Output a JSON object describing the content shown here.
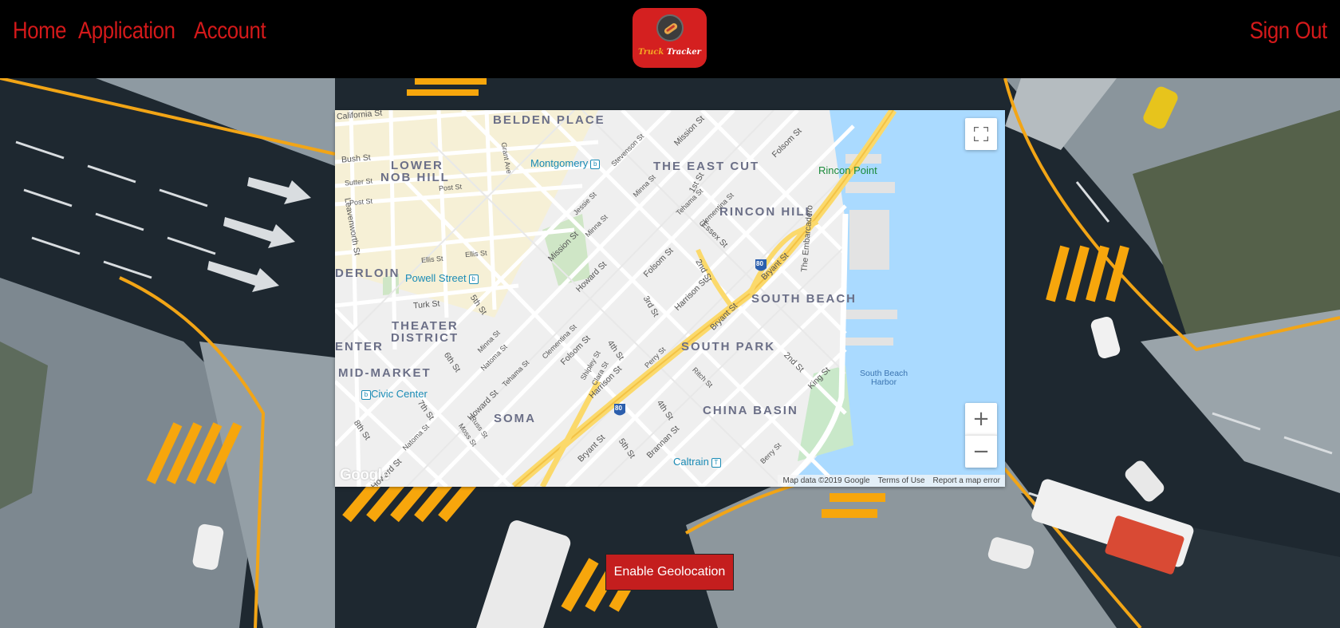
{
  "header": {
    "nav": [
      {
        "label": "Home"
      },
      {
        "label": "Application"
      },
      {
        "label": "Account"
      }
    ],
    "logo_text_1": "Truck",
    "logo_text_2": "Tracker",
    "sign_out": "Sign Out"
  },
  "map": {
    "neighborhoods": {
      "belden_place": "BELDEN PLACE",
      "lower_nob_hill_1": "LOWER",
      "lower_nob_hill_2": "NOB HILL",
      "east_cut": "THE EAST CUT",
      "rincon_hill": "RINCON HILL",
      "tenderloin": "DERLOIN",
      "theater_district_1": "THEATER",
      "theater_district_2": "DISTRICT",
      "center": "ENTER",
      "mid_market": "MID-MARKET",
      "south_beach": "SOUTH BEACH",
      "south_park": "SOUTH PARK",
      "soma": "SOMA",
      "china_basin": "CHINA BASIN"
    },
    "places": {
      "montgomery": "Montgomery",
      "powell": "Powell Street",
      "civic_center": "Civic Center",
      "caltrain": "Caltrain",
      "rincon_point": "Rincon Point",
      "south_beach_harbor_1": "South Beach",
      "south_beach_harbor_2": "Harbor"
    },
    "streets": {
      "california": "California St",
      "bush": "Bush St",
      "sutter": "Sutter St",
      "post": "Post St",
      "post2": "Post St",
      "leavenworth": "Leavenworth St",
      "ellis": "Ellis St",
      "ellis2": "Ellis St",
      "turk": "Turk St",
      "mission": "Mission St",
      "mission2": "Mission St",
      "howard": "Howard St",
      "howard2": "Howard St",
      "folsom": "Folsom St",
      "folsom2": "Folsom St",
      "folsom3": "Folsom St",
      "harrison": "Harrison St",
      "harrison2": "Harrison St",
      "bryant": "Bryant St",
      "bryant2": "Bryant St",
      "bryant3": "Bryant St",
      "essex": "Essex St",
      "embarcadero": "The Embarcadero",
      "king": "King St",
      "brannan": "Brannan St",
      "second": "2nd St",
      "second2": "2nd St",
      "third": "3rd St",
      "fourth": "4th St",
      "fourth2": "4th St",
      "fifth": "5th St",
      "fifth2": "5th St",
      "sixth": "6th St",
      "seventh": "7th St",
      "eighth": "8th St",
      "first": "1st St",
      "tehama": "Tehama St",
      "tehama2": "Tehama St",
      "clementina": "Clementina St",
      "clementina2": "Clementina St",
      "minna": "Minna St",
      "minna2": "Minna St",
      "minna3": "Minna St",
      "natoma": "Natoma St",
      "natoma2": "Natoma St",
      "jessie": "Jessie St",
      "stevenson": "Stevenson St",
      "grant": "Grant Ave",
      "perry": "Perry St",
      "ritch": "Ritch St",
      "berry": "Berry St",
      "russ": "Russ St",
      "moss": "Moss St",
      "shipley": "Shipley St",
      "clara": "Clara St",
      "hubbell": "Howard St"
    },
    "highway": "80",
    "controls": {
      "zoom_in": "+",
      "zoom_out": "−"
    },
    "attribution": {
      "map_data": "Map data ©2019 Google",
      "terms": "Terms of Use",
      "report": "Report a map error"
    },
    "google": "Google"
  },
  "geolocation_button": "Enable Geolocation"
}
